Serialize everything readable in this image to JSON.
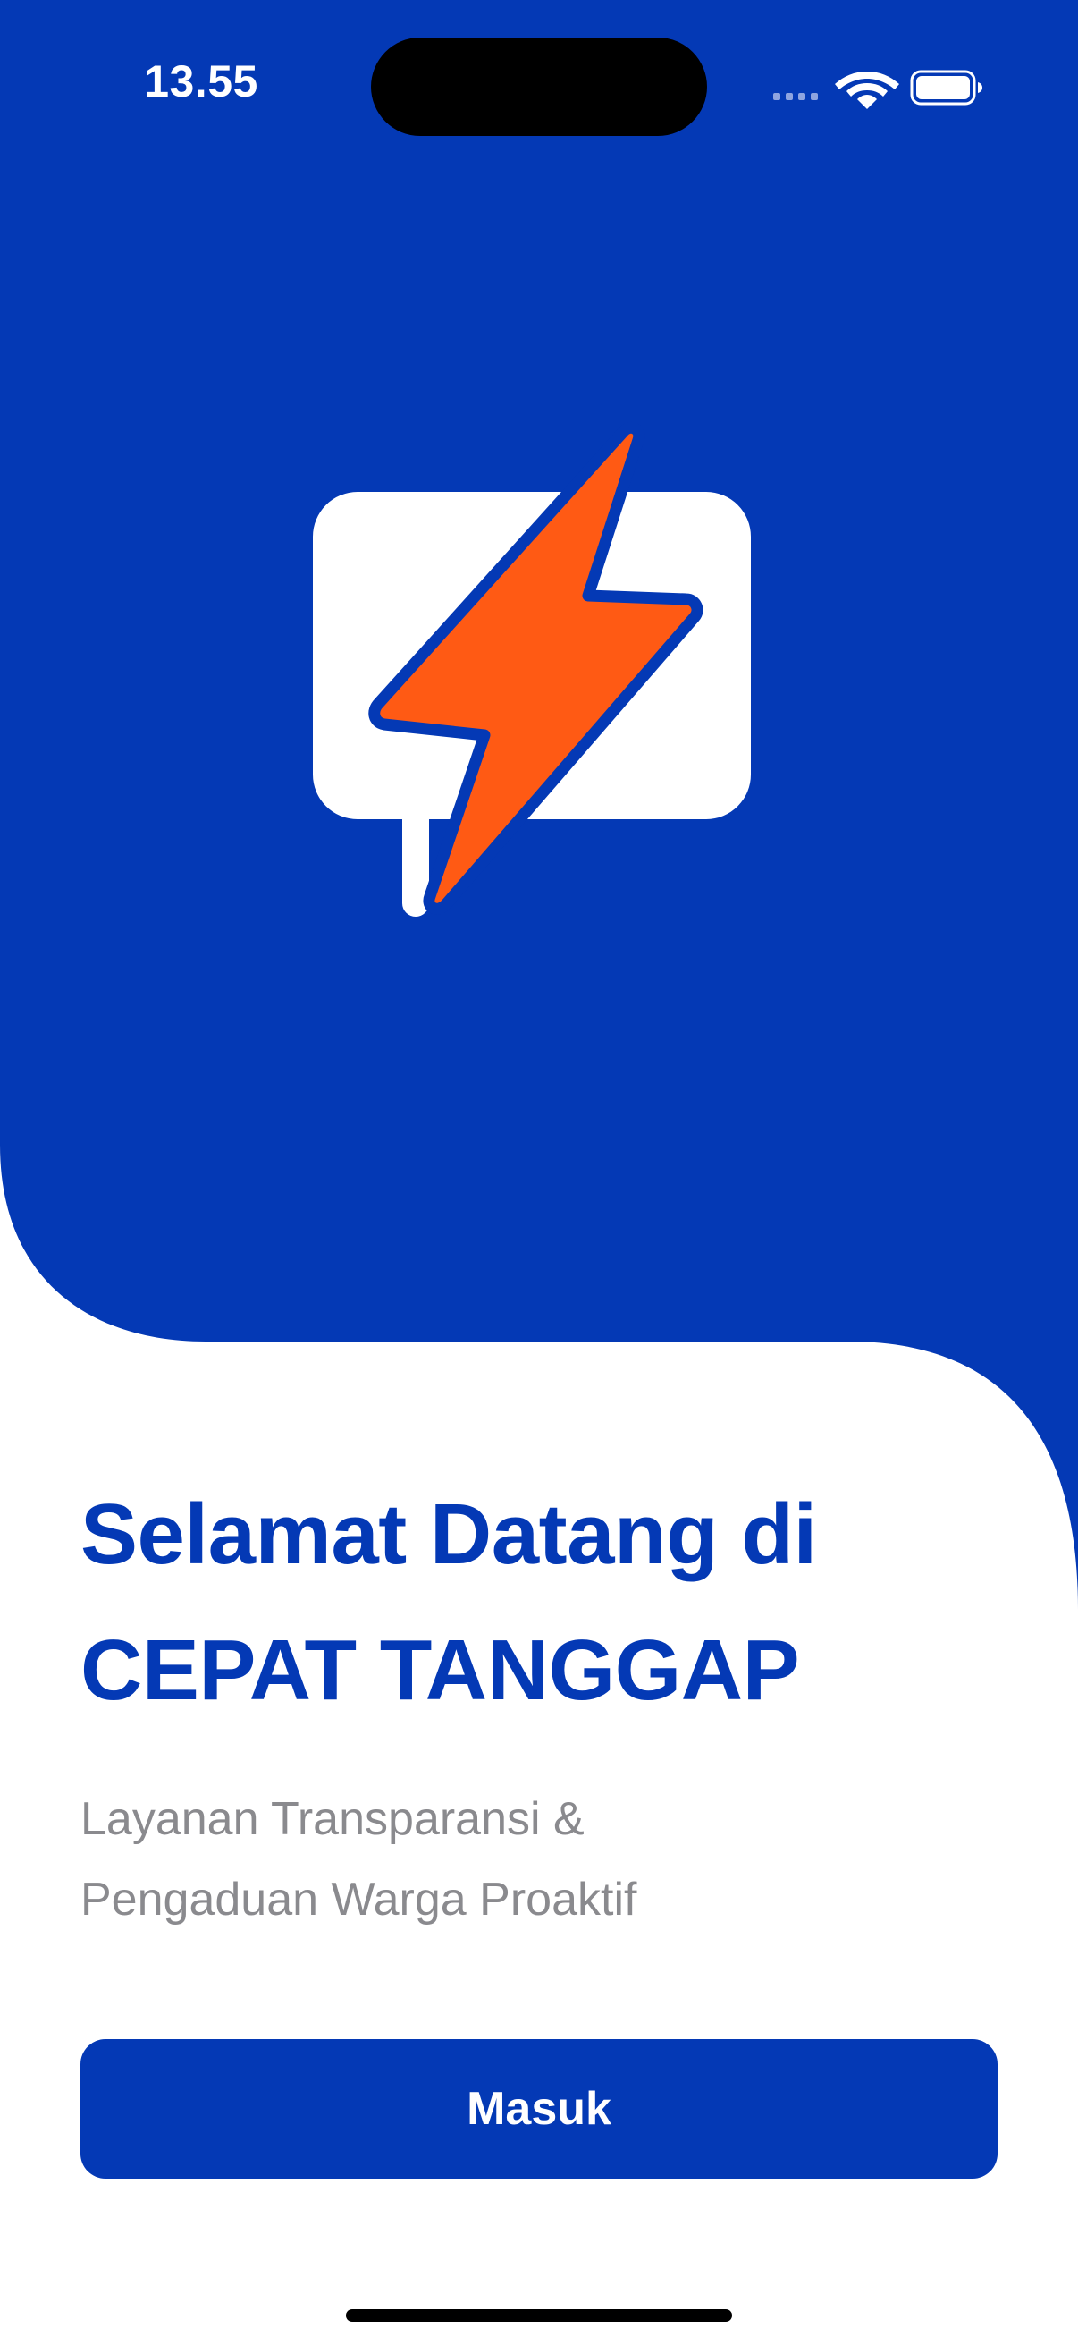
{
  "status_bar": {
    "time": "13.55",
    "signal_icon": "cellular-signal-icon",
    "wifi_icon": "wifi-icon",
    "battery_icon": "battery-icon"
  },
  "logo": {
    "icon": "chat-bubble-lightning-icon"
  },
  "welcome": {
    "title": "Selamat Datang di CEPAT TANGGAP",
    "subtitle": "Layanan Transparansi & Pengaduan Warga Proaktif"
  },
  "actions": {
    "login_label": "Masuk"
  },
  "colors": {
    "brand_blue": "#0439b5",
    "accent_orange": "#ff5a14",
    "subtitle_gray": "#8a8a8e"
  }
}
